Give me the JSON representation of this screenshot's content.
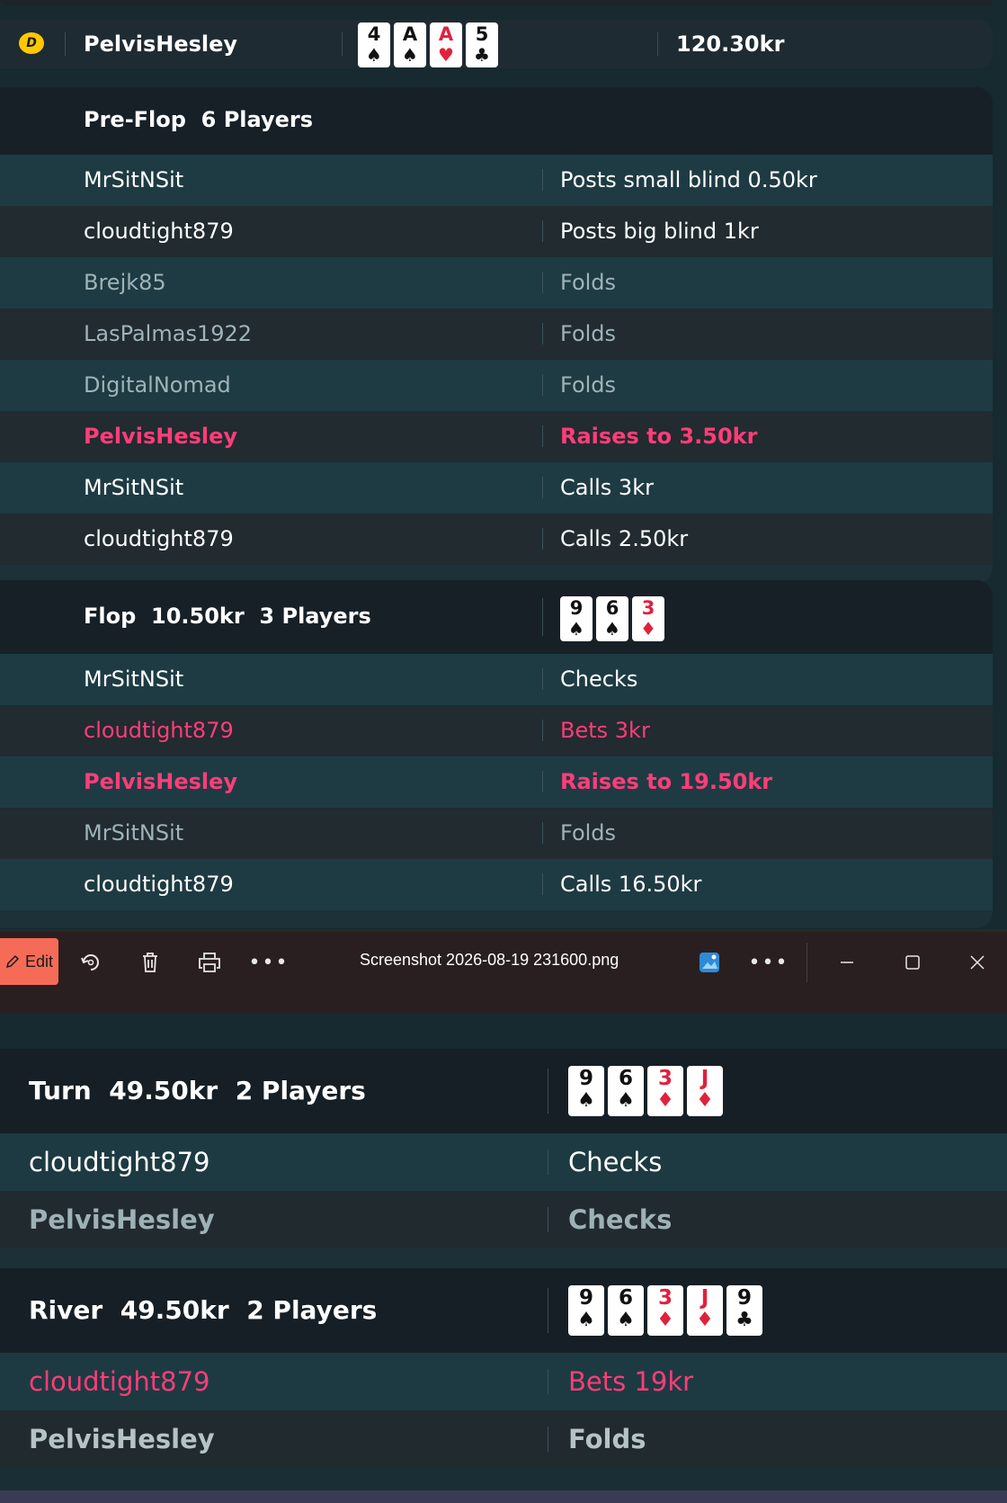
{
  "hero": {
    "dealer_badge": "D",
    "name": "PelvisHesley",
    "cards": [
      {
        "rank": "4",
        "suit": "♠",
        "color": "black"
      },
      {
        "rank": "A",
        "suit": "♠",
        "color": "black"
      },
      {
        "rank": "A",
        "suit": "♥",
        "color": "red"
      },
      {
        "rank": "5",
        "suit": "♣",
        "color": "black"
      }
    ],
    "amount": "120.30kr"
  },
  "preflop": {
    "title": "Pre-Flop  6 Players",
    "rows": [
      {
        "player": "MrSitNSit",
        "action": "Posts small blind 0.50kr",
        "style": "white"
      },
      {
        "player": "cloudtight879",
        "action": "Posts big blind 1kr",
        "style": "white"
      },
      {
        "player": "Brejk85",
        "action": "Folds",
        "style": "dim"
      },
      {
        "player": "LasPalmas1922",
        "action": "Folds",
        "style": "dim"
      },
      {
        "player": "DigitalNomad",
        "action": "Folds",
        "style": "dim"
      },
      {
        "player": "PelvisHesley",
        "action": "Raises to 3.50kr",
        "style": "pinkbold"
      },
      {
        "player": "MrSitNSit",
        "action": "Calls 3kr",
        "style": "white"
      },
      {
        "player": "cloudtight879",
        "action": "Calls 2.50kr",
        "style": "white"
      }
    ]
  },
  "flop": {
    "title": "Flop  10.50kr  3 Players",
    "cards": [
      {
        "rank": "9",
        "suit": "♠",
        "color": "black"
      },
      {
        "rank": "6",
        "suit": "♠",
        "color": "black"
      },
      {
        "rank": "3",
        "suit": "♦",
        "color": "red"
      }
    ],
    "rows": [
      {
        "player": "MrSitNSit",
        "action": "Checks",
        "style": "white"
      },
      {
        "player": "cloudtight879",
        "action": "Bets 3kr",
        "style": "pink"
      },
      {
        "player": "PelvisHesley",
        "action": "Raises to 19.50kr",
        "style": "pinkbold"
      },
      {
        "player": "MrSitNSit",
        "action": "Folds",
        "style": "dim"
      },
      {
        "player": "cloudtight879",
        "action": "Calls 16.50kr",
        "style": "white"
      }
    ]
  },
  "toolbar": {
    "edit_label": "Edit",
    "filename": "Screenshot 2026-08-19 231600.png",
    "icons": [
      "edit-icon",
      "rotate-icon",
      "delete-icon",
      "print-icon",
      "more-icon",
      "photos-app-icon",
      "more-icon",
      "minimize-icon",
      "maximize-icon",
      "close-icon"
    ]
  },
  "turn": {
    "title": "Turn  49.50kr  2 Players",
    "cards": [
      {
        "rank": "9",
        "suit": "♠",
        "color": "black"
      },
      {
        "rank": "6",
        "suit": "♠",
        "color": "black"
      },
      {
        "rank": "3",
        "suit": "♦",
        "color": "red"
      },
      {
        "rank": "J",
        "suit": "♦",
        "color": "red"
      }
    ],
    "rows": [
      {
        "player": "cloudtight879",
        "action": "Checks",
        "style": "white"
      },
      {
        "player": "PelvisHesley",
        "action": "Checks",
        "style": "mutebold"
      }
    ]
  },
  "river": {
    "title": "River  49.50kr  2 Players",
    "cards": [
      {
        "rank": "9",
        "suit": "♠",
        "color": "black"
      },
      {
        "rank": "6",
        "suit": "♠",
        "color": "black"
      },
      {
        "rank": "3",
        "suit": "♦",
        "color": "red"
      },
      {
        "rank": "J",
        "suit": "♦",
        "color": "red"
      },
      {
        "rank": "9",
        "suit": "♣",
        "color": "black"
      }
    ],
    "rows": [
      {
        "player": "cloudtight879",
        "action": "Bets 19kr",
        "style": "pink"
      },
      {
        "player": "PelvisHesley",
        "action": "Folds",
        "style": "greybold"
      }
    ]
  },
  "colors": {
    "pink": "#ff3d78",
    "dealer_yellow": "#ffc800",
    "edit_button": "#f56b57"
  }
}
